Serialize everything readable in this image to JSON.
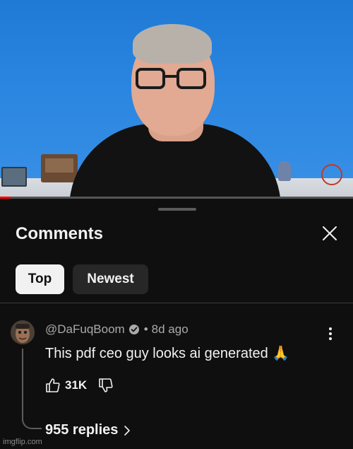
{
  "video": {
    "progress_fraction": 0.03,
    "progress_color": "#ff0000"
  },
  "comments_panel": {
    "title": "Comments",
    "close_icon": "close-icon",
    "sort_tabs": [
      {
        "label": "Top",
        "selected": true
      },
      {
        "label": "Newest",
        "selected": false
      }
    ]
  },
  "comment": {
    "author": "@DaFuqBoom",
    "verified_icon": "verified-check-icon",
    "separator": "•",
    "time": "8d ago",
    "text": "This pdf ceo guy looks ai generated 🙏",
    "like_count": "31K",
    "replies_label": "955 replies"
  },
  "watermark": "imgflip.com"
}
